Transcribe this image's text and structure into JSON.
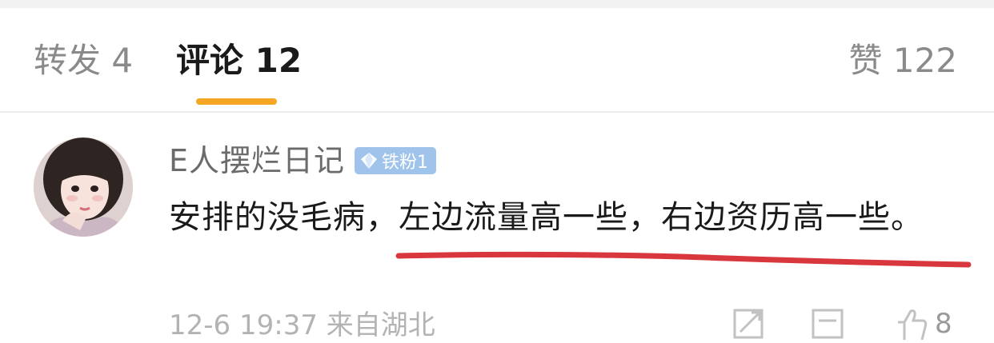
{
  "tabs": {
    "reposts": "转发 4",
    "comments": "评论 12",
    "likes": "赞 122"
  },
  "comment": {
    "username": "E人摆烂日记",
    "badge": "铁粉1",
    "text": "安排的没毛病，左边流量高一些，右边资历高一些。",
    "meta": "12-6 19:37  来自湖北",
    "like_count": "8"
  },
  "colors": {
    "active_indicator": "#f5a623",
    "annotation_underline": "#d8383d",
    "badge_bg": "#9fc3ea"
  },
  "icons": [
    "diamond-icon",
    "share-icon",
    "comment-icon",
    "thumbs-up-icon"
  ]
}
